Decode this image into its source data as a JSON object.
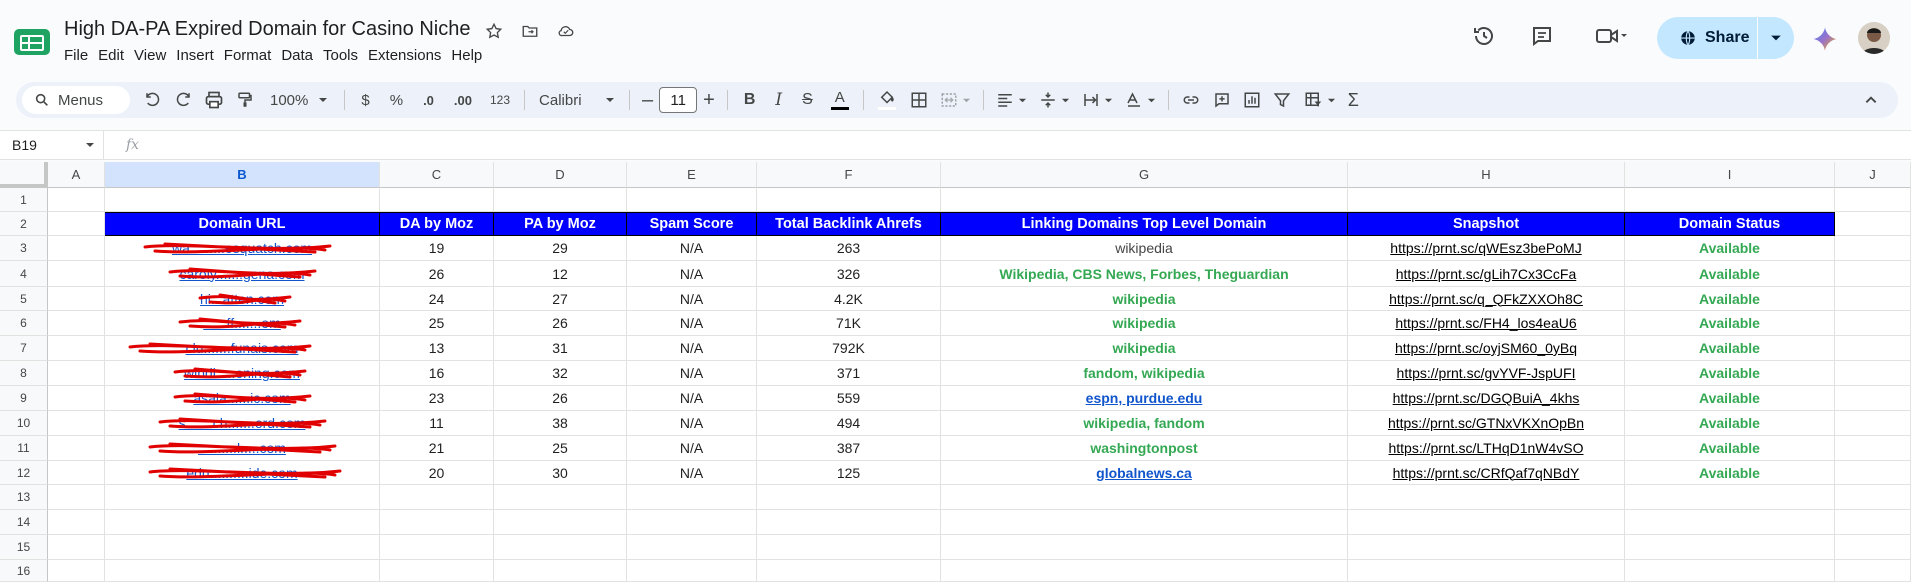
{
  "doc": {
    "title": "High DA-PA Expired Domain for Casino Niche",
    "menus": [
      "File",
      "Edit",
      "View",
      "Insert",
      "Format",
      "Data",
      "Tools",
      "Extensions",
      "Help"
    ],
    "share_label": "Share"
  },
  "toolbar": {
    "search_label": "Menus",
    "zoom": "100%",
    "currency": "$",
    "percent": "%",
    "dec_decrease": ".0",
    "dec_increase": ".00",
    "number_format": "123",
    "font": "Calibri",
    "font_size": "11"
  },
  "formula": {
    "cell_ref": "B19",
    "fx": "fx"
  },
  "columns": [
    "A",
    "B",
    "C",
    "D",
    "E",
    "F",
    "G",
    "H",
    "I",
    "J"
  ],
  "rows": [
    "1",
    "2",
    "3",
    "4",
    "5",
    "6",
    "7",
    "8",
    "9",
    "10",
    "11",
    "12",
    "13",
    "14",
    "15",
    "16"
  ],
  "header": [
    "Domain URL",
    "DA by Moz",
    "PA by Moz",
    "Spam Score",
    "Total Backlink Ahrefs",
    "Linking Domains Top Level Domain",
    "Snapshot",
    "Domain Status"
  ],
  "table": [
    {
      "url": "wa.........esquatch.com",
      "da": "19",
      "pa": "29",
      "spam": "N/A",
      "backlinks": "263",
      "tld": "wikipedia",
      "tld_style": "plain",
      "snapshot": "https://prnt.sc/qWEsz3bePoMJ",
      "status": "Available"
    },
    {
      "url": "caroly.......gena.com",
      "da": "26",
      "pa": "12",
      "spam": "N/A",
      "backlinks": "326",
      "tld": "Wikipedia, CBS News, Forbes, Theguardian",
      "tld_style": "green",
      "snapshot": "https://prnt.sc/gLih7Cx3CcFa",
      "status": "Available"
    },
    {
      "url": "hi...atten.com",
      "da": "24",
      "pa": "27",
      "spam": "N/A",
      "backlinks": "4.2K",
      "tld": "wikipedia",
      "tld_style": "green",
      "snapshot": "https://prnt.sc/q_QFkZXXOh8C",
      "status": "Available"
    },
    {
      "url": "......ff.......om",
      "da": "25",
      "pa": "26",
      "spam": "N/A",
      "backlinks": "71K",
      "tld": "wikipedia",
      "tld_style": "green",
      "snapshot": "https://prnt.sc/FH4_los4eaU6",
      "status": "Available"
    },
    {
      "url": "clu.......funais.com",
      "da": "13",
      "pa": "31",
      "spam": "N/A",
      "backlinks": "792K",
      "tld": "wikipedia",
      "tld_style": "green",
      "snapshot": "https://prnt.sc/oyjSM60_0yBq",
      "status": "Available"
    },
    {
      "url": "windi.....oning.com",
      "da": "16",
      "pa": "32",
      "spam": "N/A",
      "backlinks": "371",
      "tld": "fandom, wikipedia",
      "tld_style": "green",
      "snapshot": "https://prnt.sc/gvYVF-JspUFI",
      "status": "Available"
    },
    {
      "url": "asala......ic.com",
      "da": "23",
      "pa": "26",
      "spam": "N/A",
      "backlinks": "559",
      "tld": "espn, purdue.edu",
      "tld_style": "blue-link",
      "snapshot": "https://prnt.sc/DGQBuiA_4khs",
      "status": "Available"
    },
    {
      "url": "s.......ch.......ord.com",
      "da": "11",
      "pa": "38",
      "spam": "N/A",
      "backlinks": "494",
      "tld": "wikipedia, fandom",
      "tld_style": "green",
      "snapshot": "https://prnt.sc/GTNxVKXnOpBn",
      "status": "Available"
    },
    {
      "url": "..........l.....com",
      "da": "21",
      "pa": "25",
      "spam": "N/A",
      "backlinks": "387",
      "tld": "washingtonpost",
      "tld_style": "green",
      "snapshot": "https://prnt.sc/LTHqD1nW4vSO",
      "status": "Available"
    },
    {
      "url": "edu..........ide.com",
      "da": "20",
      "pa": "30",
      "spam": "N/A",
      "backlinks": "125",
      "tld": "globalnews.ca",
      "tld_style": "blue-link",
      "snapshot": "https://prnt.sc/CRfQaf7qNBdY",
      "status": "Available"
    }
  ],
  "colors": {
    "header_bg": "#0000ff",
    "status_green": "#34a853",
    "link_blue": "#1155cc",
    "redaction": "#e00000"
  }
}
